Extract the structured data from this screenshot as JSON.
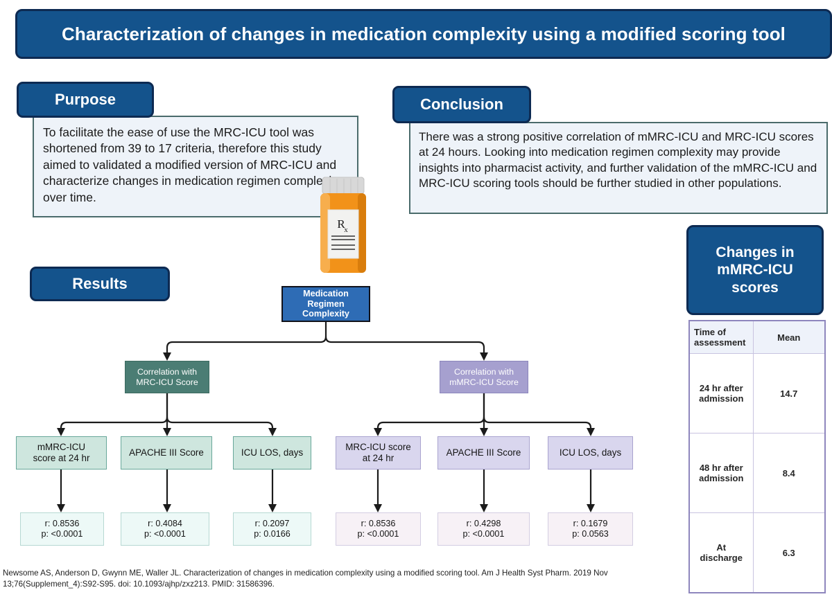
{
  "title": "Characterization of changes in medication complexity using a modified scoring tool",
  "sections": {
    "purpose": {
      "badge": "Purpose",
      "body": "To facilitate the ease of use the MRC-ICU tool was shortened from 39 to 17 criteria, therefore this study aimed to validated a modified version of MRC-ICU and characterize changes in medication regimen complexity over time."
    },
    "conclusion": {
      "badge": "Conclusion",
      "body": "There was a strong positive correlation of mMRC-ICU and MRC-ICU scores at 24 hours.  Looking into medication regimen complexity may provide insights into pharmacist activity, and further validation of the mMRC-ICU and MRC-ICU scoring tools should be further studied in other populations."
    },
    "results": {
      "badge": "Results"
    }
  },
  "illustration": {
    "label": "rx-pill-bottle-icon",
    "rx_text": "R"
  },
  "flowchart": {
    "root": {
      "line1": "Medication",
      "line2": "Regimen",
      "line3": "Complexity"
    },
    "branches": [
      {
        "id": "mrc",
        "header_line1": "Correlation with",
        "header_line2": "MRC-ICU Score",
        "leaves": [
          {
            "line1": "mMRC-ICU",
            "line2": "score at 24 hr",
            "r": "r: 0.8536",
            "p": "p: <0.0001"
          },
          {
            "line1": "APACHE III Score",
            "line2": "",
            "r": "r: 0.4084",
            "p": "p: <0.0001"
          },
          {
            "line1": "ICU LOS, days",
            "line2": "",
            "r": "r: 0.2097",
            "p": "p: 0.0166"
          }
        ]
      },
      {
        "id": "mmrc",
        "header_line1": "Correlation with",
        "header_line2": "mMRC-ICU Score",
        "leaves": [
          {
            "line1": "MRC-ICU score",
            "line2": "at 24 hr",
            "r": "r: 0.8536",
            "p": "p: <0.0001"
          },
          {
            "line1": "APACHE III Score",
            "line2": "",
            "r": "r: 0.4298",
            "p": "p: <0.0001"
          },
          {
            "line1": "ICU LOS, days",
            "line2": "",
            "r": "r: 0.1679",
            "p": "p: 0.0563"
          }
        ]
      }
    ]
  },
  "changes_panel": {
    "badge_line1": "Changes in",
    "badge_line2": "mMRC-ICU",
    "badge_line3": "scores",
    "table": {
      "headers": [
        "Time of assessment",
        "Mean"
      ],
      "header_col1_line1": "Time of",
      "header_col1_line2": "assessment",
      "rows": [
        {
          "time_line1": "24 hr after",
          "time_line2": "admission",
          "mean": "14.7"
        },
        {
          "time_line1": "48 hr after",
          "time_line2": "admission",
          "mean": "8.4"
        },
        {
          "time_line1": "At",
          "time_line2": "discharge",
          "mean": "6.3"
        }
      ]
    }
  },
  "citation": "Newsome AS, Anderson D, Gwynn ME, Waller JL. Characterization of changes in medication complexity using a modified scoring tool. Am J Health Syst Pharm. 2019 Nov 13;76(Supplement_4):S92-S95. doi: 10.1093/ajhp/zxz213. PMID: 31586396.",
  "colors": {
    "brand_blue": "#14538c",
    "brand_blue_border": "#0d2a52",
    "root_box_blue": "#2e6cb5",
    "green_header": "#4b7d74",
    "purple_header": "#a6a0cf",
    "green_leaf": "#cee6de",
    "purple_leaf": "#d9d6ee",
    "green_result": "#edf9f7",
    "purple_result": "#f7f1f6",
    "panel_bg": "#eef3f9",
    "panel_border": "#4a6b6b",
    "table_border": "#8e86bd",
    "pill_orange": "#f29219"
  }
}
